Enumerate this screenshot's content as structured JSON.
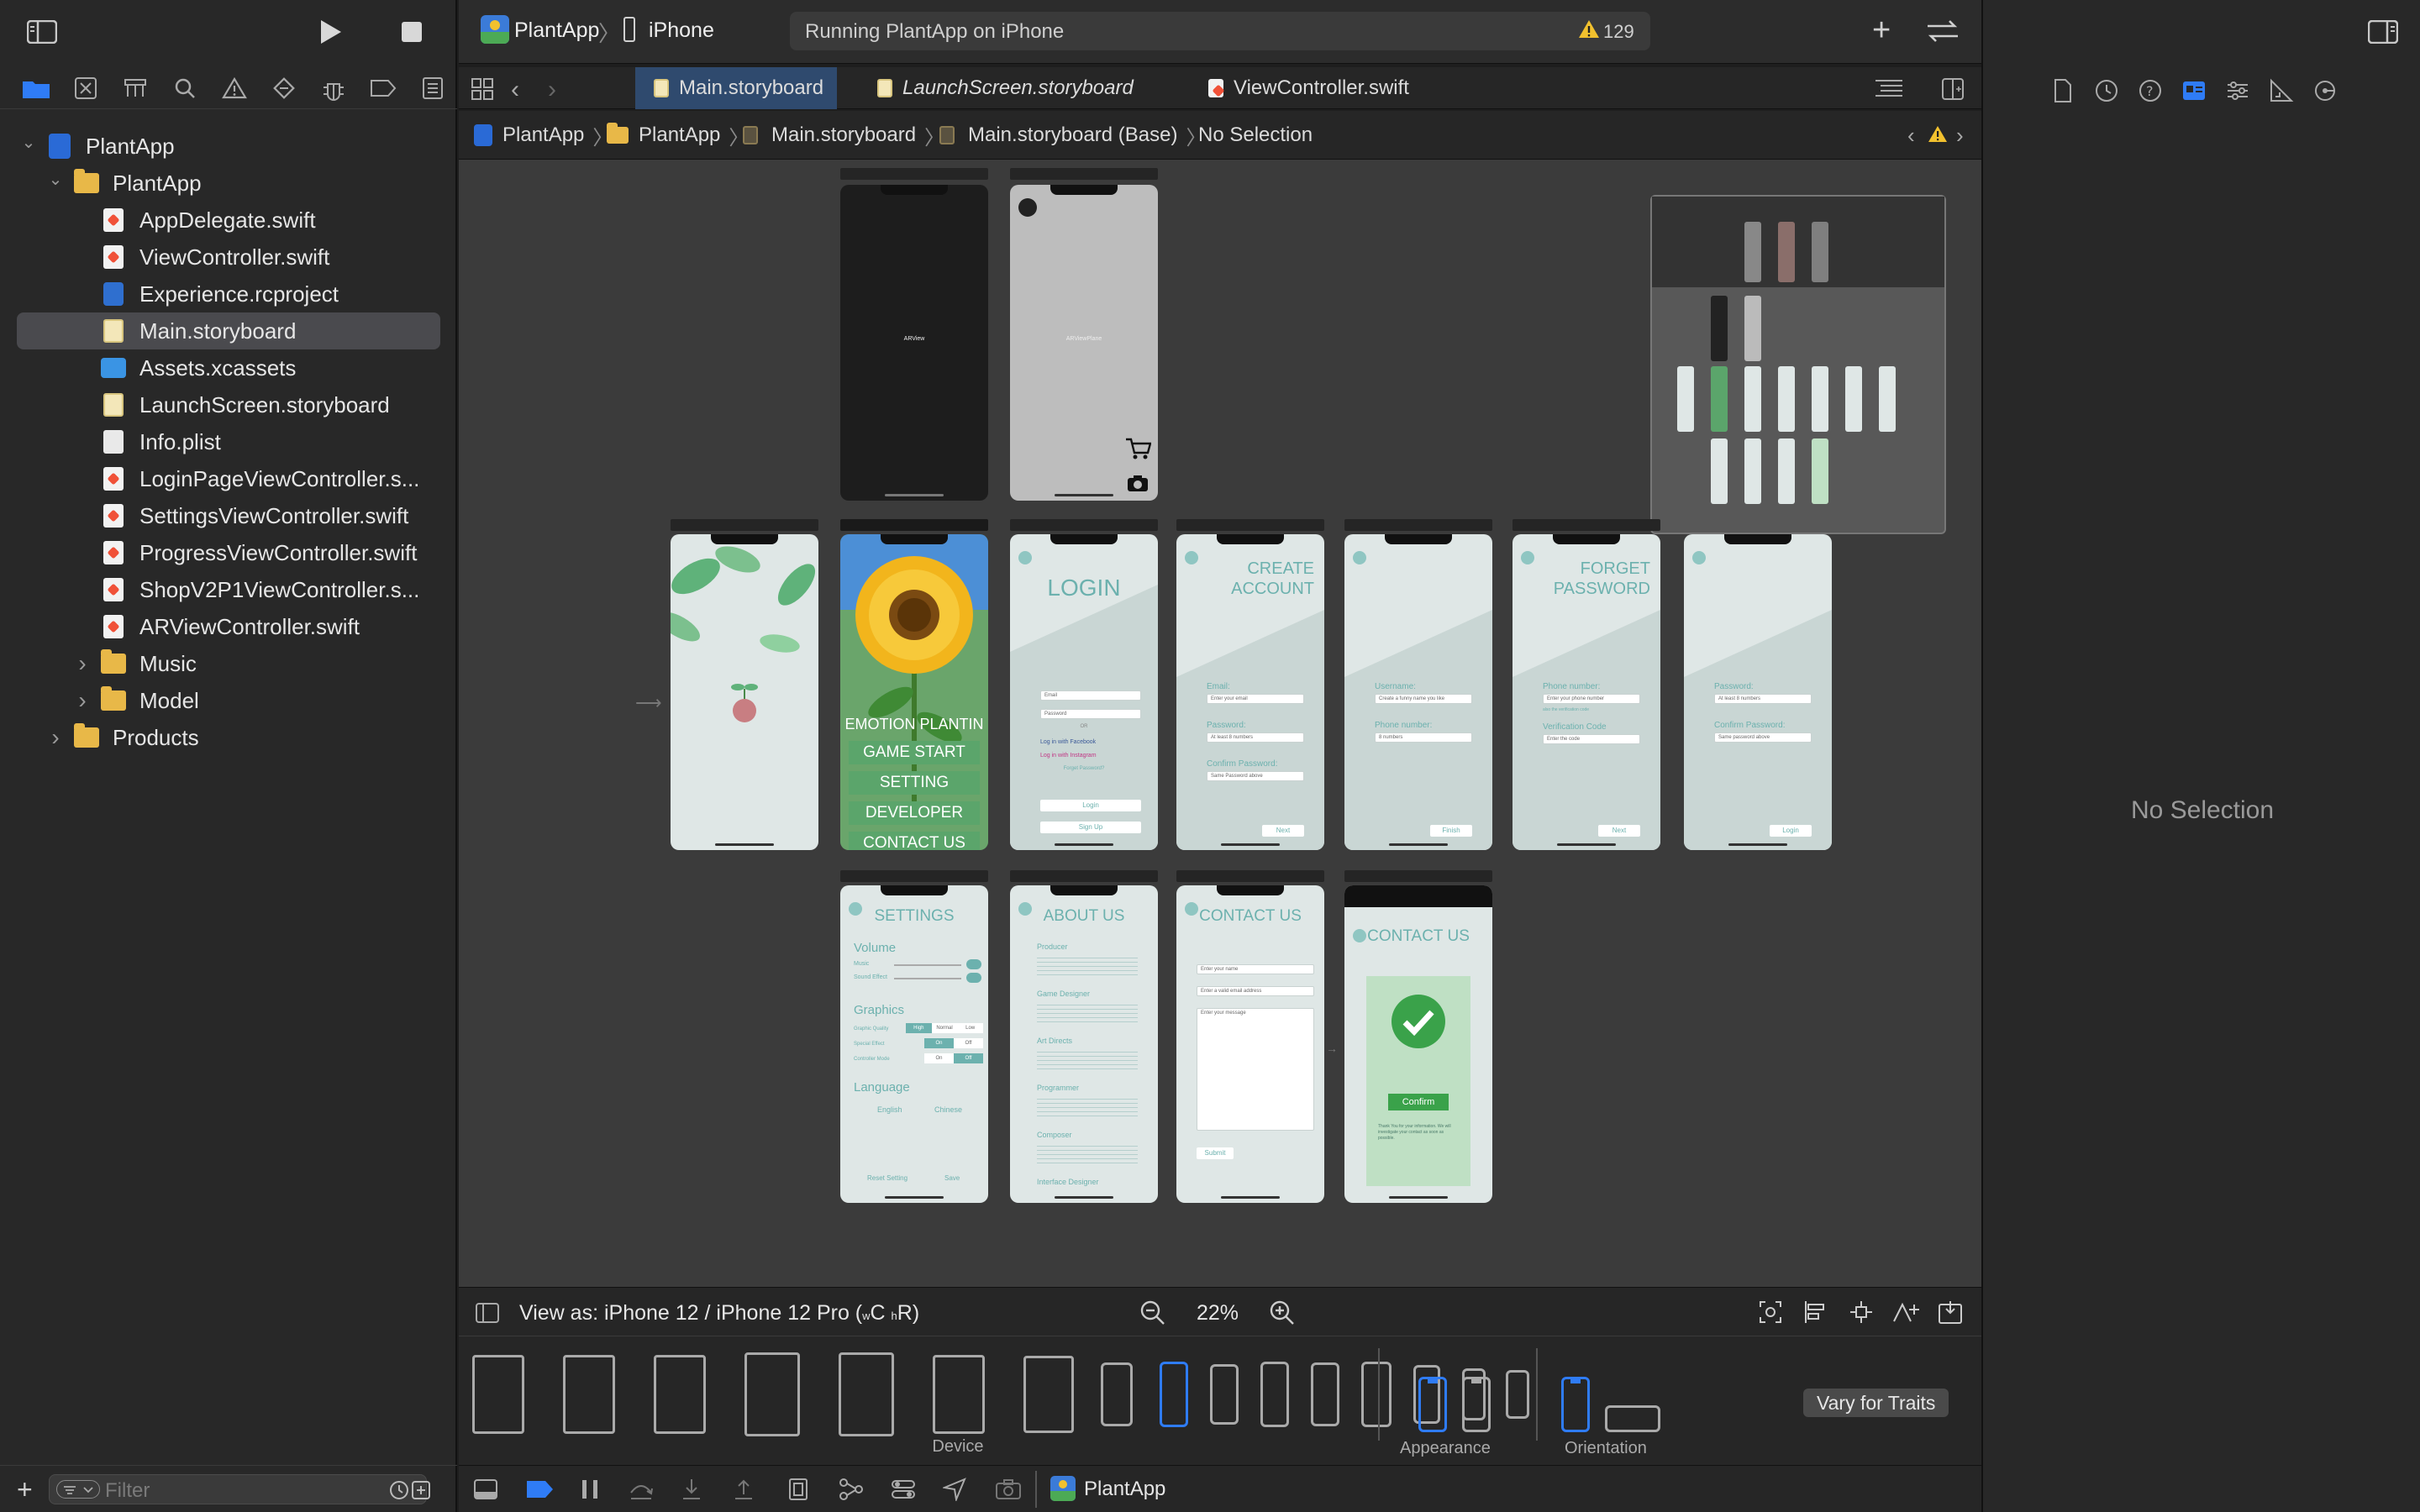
{
  "toolbar": {
    "scheme": "PlantApp",
    "destination": "iPhone",
    "status": "Running PlantApp on iPhone",
    "warnings": "129"
  },
  "navigator": {
    "items": [
      {
        "label": "PlantApp",
        "kind": "project",
        "indent": 0,
        "expanded": true
      },
      {
        "label": "PlantApp",
        "kind": "folder",
        "indent": 1,
        "expanded": true
      },
      {
        "label": "AppDelegate.swift",
        "kind": "swift",
        "indent": 2
      },
      {
        "label": "ViewController.swift",
        "kind": "swift",
        "indent": 2
      },
      {
        "label": "Experience.rcproject",
        "kind": "rc",
        "indent": 2
      },
      {
        "label": "Main.storyboard",
        "kind": "storyboard",
        "indent": 2,
        "selected": true
      },
      {
        "label": "Assets.xcassets",
        "kind": "assets",
        "indent": 2
      },
      {
        "label": "LaunchScreen.storyboard",
        "kind": "storyboard",
        "indent": 2
      },
      {
        "label": "Info.plist",
        "kind": "plist",
        "indent": 2
      },
      {
        "label": "LoginPageViewController.s...",
        "kind": "swift",
        "indent": 2
      },
      {
        "label": "SettingsViewController.swift",
        "kind": "swift",
        "indent": 2
      },
      {
        "label": "ProgressViewController.swift",
        "kind": "swift",
        "indent": 2
      },
      {
        "label": "ShopV2P1ViewController.s...",
        "kind": "swift",
        "indent": 2
      },
      {
        "label": "ARViewController.swift",
        "kind": "swift",
        "indent": 2
      },
      {
        "label": "Music",
        "kind": "folder",
        "indent": 2,
        "expanded": false
      },
      {
        "label": "Model",
        "kind": "folder",
        "indent": 2,
        "expanded": false
      },
      {
        "label": "Products",
        "kind": "folder",
        "indent": 1,
        "expanded": false
      }
    ],
    "filter_placeholder": "Filter"
  },
  "tabs": [
    {
      "label": "Main.storyboard",
      "active": true
    },
    {
      "label": "LaunchScreen.storyboard",
      "active": false
    },
    {
      "label": "ViewController.swift",
      "active": false
    }
  ],
  "jumpbar": [
    "PlantApp",
    "PlantApp",
    "Main.storyboard",
    "Main.storyboard (Base)",
    "No Selection"
  ],
  "storyboard": {
    "ar_label": "ARView",
    "ar2_label": "ARViewPlane",
    "emotion_title": "EMOTION PLANTIN",
    "menu": [
      "GAME START",
      "SETTING",
      "DEVELOPER",
      "CONTACT US"
    ],
    "login_title": "LOGIN",
    "login_fields": [
      "Email",
      "Password"
    ],
    "login_or": "OR",
    "login_facebook": "Log in with Facebook",
    "login_instagram": "Log in with Instagram",
    "login_forgot": "Forget Password?",
    "login_btn": "Login",
    "signup_btn": "Sign Up",
    "create_title_1": "CREATE",
    "create_title_2": "ACCOUNT",
    "create_labels": [
      "Email:",
      "Password:",
      "Confirm Password:"
    ],
    "create_fields": [
      "Enter your email",
      "At least 8 numbers",
      "Same Password above"
    ],
    "next": "Next",
    "user_labels": [
      "Username:",
      "Phone number:"
    ],
    "user_fields": [
      "Create a funny name you like",
      "8 numbers"
    ],
    "finish": "Finish",
    "forget_title_1": "FORGET",
    "forget_title_2": "PASSWORD",
    "forget_labels": [
      "Phone number:",
      "Verification Code"
    ],
    "forget_fields": [
      "Enter your phone number",
      "Enter the code"
    ],
    "forget_hint": "also the verification code",
    "reset_labels": [
      "Password:",
      "Confirm Password:"
    ],
    "reset_fields": [
      "At least 8 numbers",
      "Same password above"
    ],
    "login": "Login",
    "settings_title": "SETTINGS",
    "settings_volume": "Volume",
    "settings_music": "Music",
    "settings_sound": "Sound Effect",
    "settings_graphics": "Graphics",
    "settings_quality": "Graphic Quality",
    "settings_quality_opts": [
      "High",
      "Normal",
      "Low"
    ],
    "settings_special": "Special Effect",
    "settings_control": "Controller Mode",
    "settings_onoff": [
      "On",
      "Off"
    ],
    "settings_language": "Language",
    "settings_langs": [
      "English",
      "Chinese"
    ],
    "settings_reset": "Reset Setting",
    "settings_save": "Save",
    "about_title": "ABOUT US",
    "about_sections": [
      "Producer",
      "Game Designer",
      "Art Directs",
      "Programmer",
      "Composer",
      "Interface Designer"
    ],
    "contact_title": "CONTACT US",
    "contact_fields": [
      "Enter your name",
      "Enter a valid email address",
      "Enter your message"
    ],
    "submit": "Submit",
    "confirm_title": "CONTACT US",
    "confirm_btn": "Confirm",
    "confirm_msg": "Thank You for your information. We will investigate your contact as soon as possible."
  },
  "bottom": {
    "view_as": "View as: iPhone 12 / iPhone 12 Pro (",
    "size_class_w": "w",
    "size_class_c": "C",
    "size_class_h": "h",
    "size_class_r": "R",
    "close_paren": ")",
    "zoom": "22%"
  },
  "device_bar": {
    "device_label": "Device",
    "appearance_label": "Appearance",
    "orientation_label": "Orientation",
    "vary": "Vary for Traits"
  },
  "debug": {
    "target": "PlantApp"
  },
  "inspector": {
    "empty": "No Selection"
  },
  "colors": {
    "accent": "#2f7cf6",
    "selected_tab": "#2f4a6e",
    "teal": "#6cb1ae",
    "menu_green": "#5ba56b",
    "warning": "#f2c12e"
  }
}
